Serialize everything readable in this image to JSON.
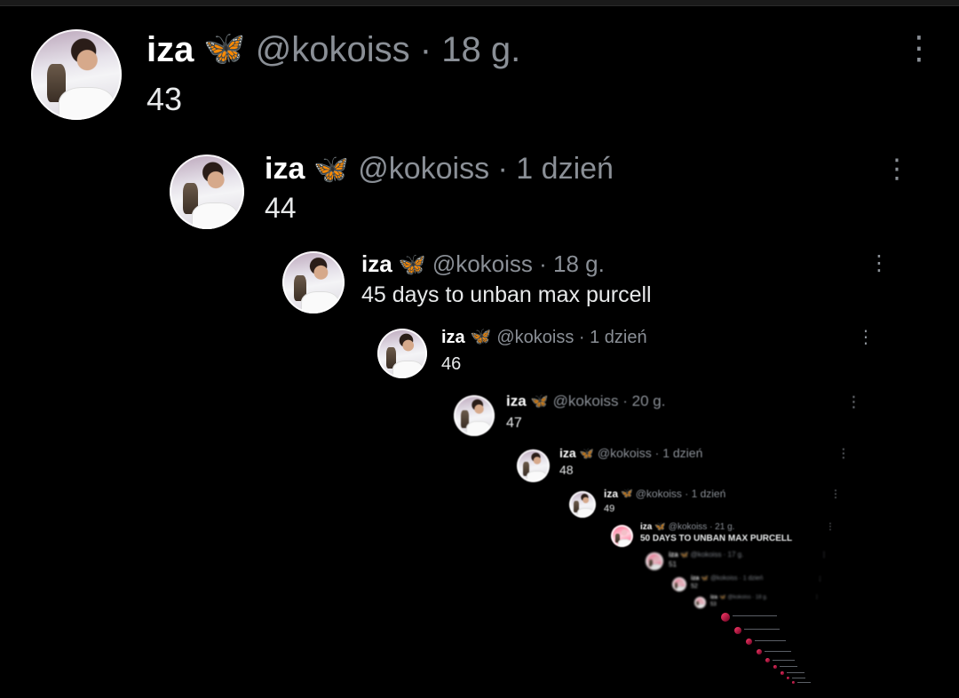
{
  "posts": [
    {
      "name": "iza",
      "handle": "@kokoiss · 18 g.",
      "text": "43"
    },
    {
      "name": "iza",
      "handle": "@kokoiss · 1 dzień",
      "text": "44"
    },
    {
      "name": "iza",
      "handle": "@kokoiss · 18 g.",
      "text": "45 days to unban max purcell"
    },
    {
      "name": "iza",
      "handle": "@kokoiss · 1 dzień",
      "text": "46"
    },
    {
      "name": "iza",
      "handle": "@kokoiss · 20 g.",
      "text": "47"
    },
    {
      "name": "iza",
      "handle": "@kokoiss · 1 dzień",
      "text": "48"
    },
    {
      "name": "iza",
      "handle": "@kokoiss · 1 dzień",
      "text": "49"
    },
    {
      "name": "iza",
      "handle": "@kokoiss · 21 g.",
      "text": "50 DAYS TO UNBAN MAX PURCELL"
    },
    {
      "name": "iza",
      "handle": "@kokoiss · 17 g.",
      "text": "51"
    },
    {
      "name": "iza",
      "handle": "@kokoiss · 1 dzień",
      "text": "52"
    },
    {
      "name": "iza",
      "handle": "@kokoiss · 18 g.",
      "text": "53"
    }
  ],
  "icons": {
    "badge": "butterfly-emoji",
    "more": "more-options-icon"
  },
  "colors": {
    "background": "#000000",
    "name": "#ffffff",
    "handle": "#8a8f96",
    "text": "#e7e9ea",
    "badge": "#3aa0ff",
    "tail": "#ff3b6b"
  }
}
